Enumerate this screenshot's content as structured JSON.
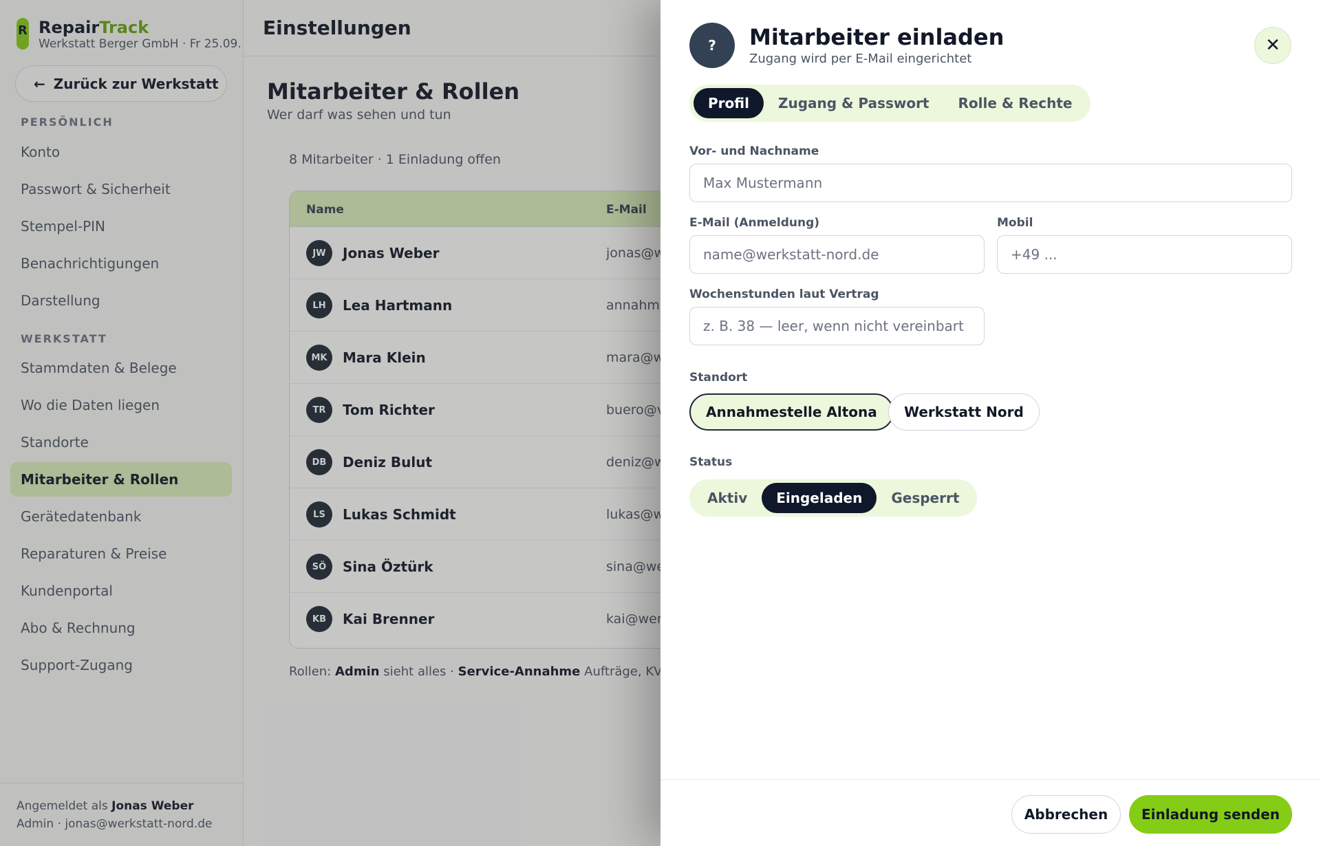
{
  "brand": {
    "logo_letter": "R",
    "name_part1": "Repair",
    "name_part2": "Track",
    "subtitle": "Werkstatt Berger GmbH · Fr 25.09."
  },
  "sidebar": {
    "back_label": "Zurück zur Werkstatt",
    "section_personal": "PERSÖNLICH",
    "section_workshop": "WERKSTATT",
    "items": [
      {
        "label": "Konto"
      },
      {
        "label": "Passwort & Sicherheit"
      },
      {
        "label": "Stempel-PIN"
      },
      {
        "label": "Benachrichtigungen"
      },
      {
        "label": "Darstellung"
      },
      {
        "label": "Stammdaten & Belege"
      },
      {
        "label": "Wo die Daten liegen"
      },
      {
        "label": "Standorte"
      },
      {
        "label": "Mitarbeiter & Rollen"
      },
      {
        "label": "Gerätedatenbank"
      },
      {
        "label": "Reparaturen & Preise"
      },
      {
        "label": "Kundenportal"
      },
      {
        "label": "Abo & Rechnung"
      },
      {
        "label": "Support-Zugang"
      }
    ],
    "active_item": "Mitarbeiter & Rollen",
    "footer": {
      "logged_in_prefix": "Angemeldet als",
      "user_name": "Jonas Weber",
      "user_detail": "Admin · jonas@werkstatt-nord.de"
    }
  },
  "main": {
    "topbar_title": "Einstellungen",
    "title": "Mitarbeiter & Rollen",
    "subtitle": "Wer darf was sehen und tun",
    "count": "8 Mitarbeiter · 1 Einladung offen",
    "table": {
      "columns": [
        "Name",
        "E-Mail"
      ],
      "rows": [
        {
          "initials": "JW",
          "name": "Jonas Weber",
          "email": "jonas@w"
        },
        {
          "initials": "LH",
          "name": "Lea Hartmann",
          "email": "annahm"
        },
        {
          "initials": "MK",
          "name": "Mara Klein",
          "email": "mara@w"
        },
        {
          "initials": "TR",
          "name": "Tom Richter",
          "email": "buero@v"
        },
        {
          "initials": "DB",
          "name": "Deniz Bulut",
          "email": "deniz@w"
        },
        {
          "initials": "LS",
          "name": "Lukas Schmidt",
          "email": "lukas@w"
        },
        {
          "initials": "SÖ",
          "name": "Sina Öztürk",
          "email": "sina@we"
        },
        {
          "initials": "KB",
          "name": "Kai Brenner",
          "email": "kai@wer"
        }
      ]
    },
    "roles_line": {
      "prefix": "Rollen:",
      "role1": "Admin",
      "role1_desc": "sieht alles ·",
      "role2": "Service-Annahme",
      "role2_desc": "Aufträge, KVA,"
    }
  },
  "drawer": {
    "icon_glyph": "?",
    "title": "Mitarbeiter einladen",
    "subtitle": "Zugang wird per E-Mail eingerichtet",
    "close_glyph": "✕",
    "tabs": [
      {
        "label": "Profil"
      },
      {
        "label": "Zugang & Passwort"
      },
      {
        "label": "Rolle & Rechte"
      }
    ],
    "active_tab": "Profil",
    "fields": {
      "name_label": "Vor- und Nachname",
      "name_placeholder": "Max Mustermann",
      "email_label": "E-Mail (Anmeldung)",
      "email_placeholder": "name@werkstatt-nord.de",
      "mobile_label": "Mobil",
      "mobile_placeholder": "+49 ...",
      "hours_label": "Wochenstunden laut Vertrag",
      "hours_placeholder": "z. B. 38 — leer, wenn nicht vereinbart"
    },
    "location": {
      "label": "Standort",
      "options": [
        "Annahmestelle Altona",
        "Werkstatt Nord"
      ],
      "selected": "Annahmestelle Altona"
    },
    "status": {
      "label": "Status",
      "options": [
        "Aktiv",
        "Eingeladen",
        "Gesperrt"
      ],
      "selected": "Eingeladen"
    },
    "cancel_label": "Abbrechen",
    "send_label": "Einladung senden"
  },
  "colors": {
    "accent": "#84cc16",
    "accent_light": "#ecf7dc",
    "dark": "#0f172a"
  }
}
